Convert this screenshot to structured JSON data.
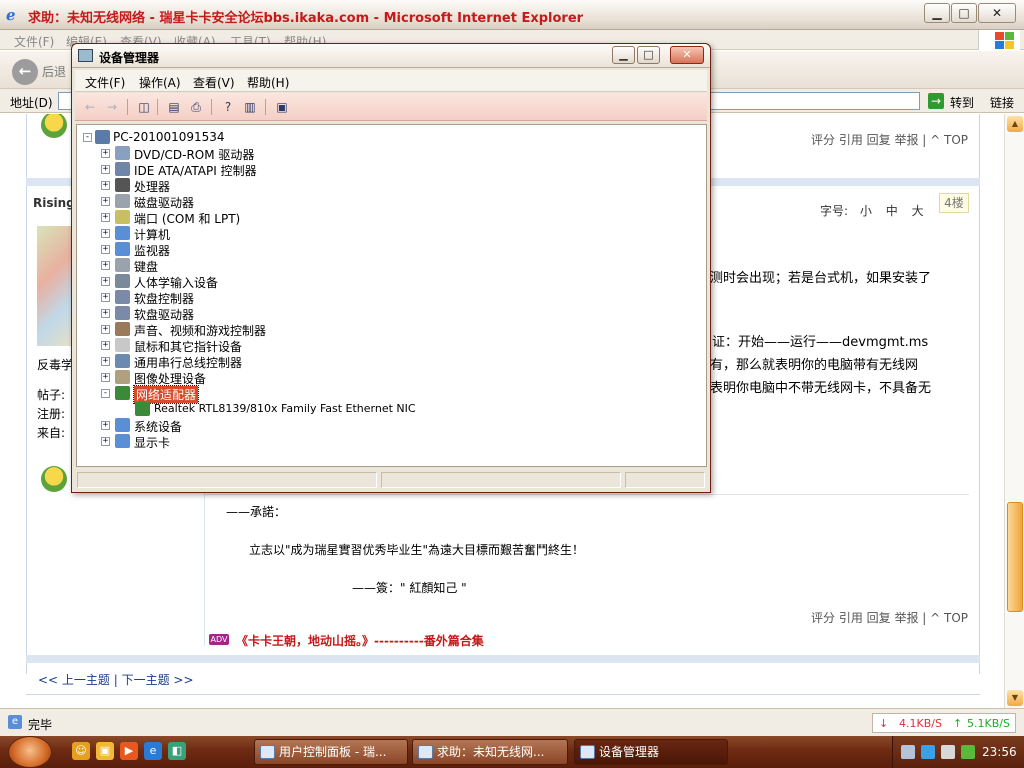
{
  "ie": {
    "title": "求助：未知无线网络 - 瑞星卡卡安全论坛bbs.ikaka.com - Microsoft Internet Explorer",
    "controls": {
      "minimize": "▁",
      "maximize": "□",
      "close": "✕"
    },
    "menu": [
      "文件(F)",
      "编辑(E)",
      "查看(V)",
      "收藏(A)",
      "工具(T)",
      "帮助(H)"
    ],
    "back_label": "后退",
    "address_label": "地址(D)",
    "address_value": "",
    "go_label": "转到",
    "links_label": "链接",
    "status_text": "完毕",
    "net_down": "4.1KB/S",
    "net_up": "5.1KB/S"
  },
  "forum": {
    "post_actions": "评分 引用 回复 举报 | ^ TOP",
    "user_name": "Rising",
    "user_subtitle": "反毒学",
    "meta_posts": "帖子:",
    "meta_register": "注册:",
    "meta_from": "来自:",
    "font_size_label": "字号:",
    "font_small": "小",
    "font_medium": "中",
    "font_large": "大",
    "floor": "4楼",
    "body_lines": [
      "测时会出现；若是台式机，如果安装了",
      "证：开始——运行——devmgmt.ms",
      "有，那么就表明你的电脑带有无线网",
      "表明你电脑中不带无线网卡，不具备无"
    ],
    "sig_line1": "——承諾：",
    "sig_line2": "立志以\"成为瑞星實習优秀毕业生\"為遠大目標而艱苦奮鬥終生！",
    "sig_line3": "——簽：\" 紅顏知己 \"",
    "adv_badge": "ADV",
    "adv_link": "《卡卡王朝，地动山摇。》----------番外篇合集",
    "thread_nav": "<< 上一主题 | 下一主题 >>"
  },
  "device_manager": {
    "title": "设备管理器",
    "menu": [
      "文件(F)",
      "操作(A)",
      "查看(V)",
      "帮助(H)"
    ],
    "root": "PC-201001091534",
    "items": [
      {
        "label": "DVD/CD-ROM 驱动器",
        "icon": "dvd-drive-icon"
      },
      {
        "label": "IDE ATA/ATAPI 控制器",
        "icon": "ide-controller-icon"
      },
      {
        "label": "处理器",
        "icon": "processor-icon"
      },
      {
        "label": "磁盘驱动器",
        "icon": "disk-drive-icon"
      },
      {
        "label": "端口 (COM 和 LPT)",
        "icon": "port-icon"
      },
      {
        "label": "计算机",
        "icon": "computer-icon"
      },
      {
        "label": "监视器",
        "icon": "monitor-icon"
      },
      {
        "label": "键盘",
        "icon": "keyboard-icon"
      },
      {
        "label": "人体学输入设备",
        "icon": "hid-icon"
      },
      {
        "label": "软盘控制器",
        "icon": "floppy-controller-icon"
      },
      {
        "label": "软盘驱动器",
        "icon": "floppy-drive-icon"
      },
      {
        "label": "声音、视频和游戏控制器",
        "icon": "sound-icon"
      },
      {
        "label": "鼠标和其它指针设备",
        "icon": "mouse-icon"
      },
      {
        "label": "通用串行总线控制器",
        "icon": "usb-icon"
      },
      {
        "label": "图像处理设备",
        "icon": "imaging-icon"
      },
      {
        "label": "网络适配器",
        "icon": "network-adapter-icon",
        "expanded": true,
        "selected": true
      },
      {
        "label": "Realtek RTL8139/810x Family Fast Ethernet NIC",
        "icon": "network-card-icon",
        "child": true
      },
      {
        "label": "系统设备",
        "icon": "system-device-icon"
      },
      {
        "label": "显示卡",
        "icon": "display-adapter-icon"
      }
    ]
  },
  "taskbar": {
    "tasks": [
      "用户控制面板 - 瑞...",
      "求助：未知无线网...",
      "设备管理器"
    ],
    "clock": "23:56"
  }
}
